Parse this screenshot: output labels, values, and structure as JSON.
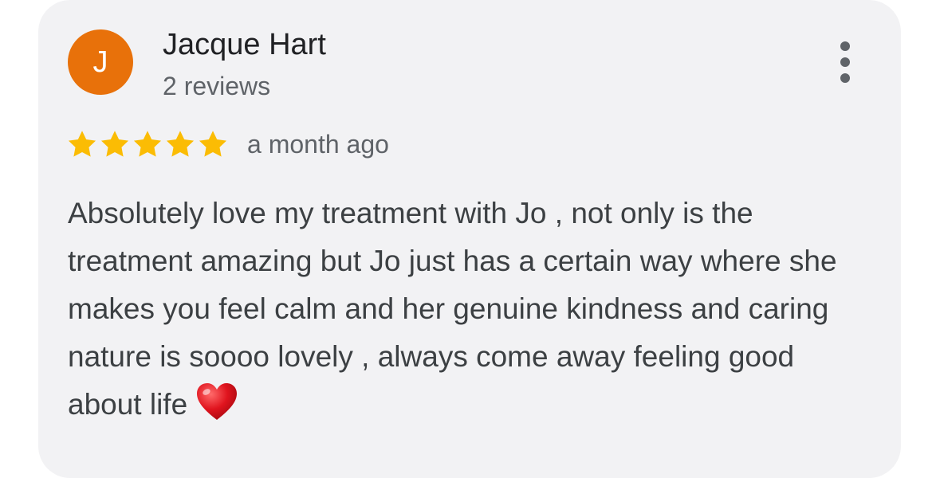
{
  "review": {
    "avatar_letter": "J",
    "author_name": "Jacque Hart",
    "review_count": "2 reviews",
    "rating": 5,
    "rating_max": 5,
    "time_ago": "a month ago",
    "text": "Absolutely love my treatment with Jo , not only is the treatment amazing but Jo just has a certain way where she makes you feel calm and her genuine kindness and caring nature is soooo lovely , always come away feeling good about life",
    "emoji": "red-heart-icon"
  },
  "colors": {
    "avatar_bg": "#e8710a",
    "star": "#fbbc04",
    "card_bg": "#f2f2f4",
    "heart": "#e0141e"
  }
}
